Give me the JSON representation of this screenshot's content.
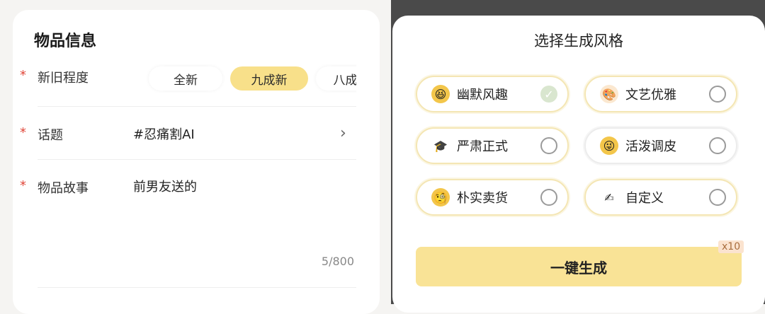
{
  "left": {
    "title": "物品信息",
    "required_mark": "*",
    "condition": {
      "label": "新旧程度",
      "options": [
        "全新",
        "九成新",
        "八成新"
      ],
      "selected": "九成新"
    },
    "topic": {
      "label": "话题",
      "value": "#忍痛割AI"
    },
    "story": {
      "label": "物品故事",
      "value": "前男友送的",
      "count": "5/800"
    }
  },
  "right": {
    "title": "选择生成风格",
    "styles": [
      {
        "label": "幽默风趣",
        "checked": true,
        "emoji_color": "#f3c64a"
      },
      {
        "label": "文艺优雅",
        "checked": false,
        "emoji_color": "#c89060"
      },
      {
        "label": "严肃正式",
        "checked": false,
        "emoji_color": "#2b2b2b"
      },
      {
        "label": "活泼调皮",
        "checked": false,
        "emoji_color": "#f3c64a"
      },
      {
        "label": "朴实卖货",
        "checked": false,
        "emoji_color": "#f3c64a"
      },
      {
        "label": "自定义",
        "checked": false,
        "emoji_color": "#e8b25a"
      }
    ],
    "generate_button": "一键生成",
    "cost_badge": "x10",
    "check_glyph": "✓"
  },
  "colors": {
    "accent": "#f9e396",
    "required": "#e0473a"
  }
}
